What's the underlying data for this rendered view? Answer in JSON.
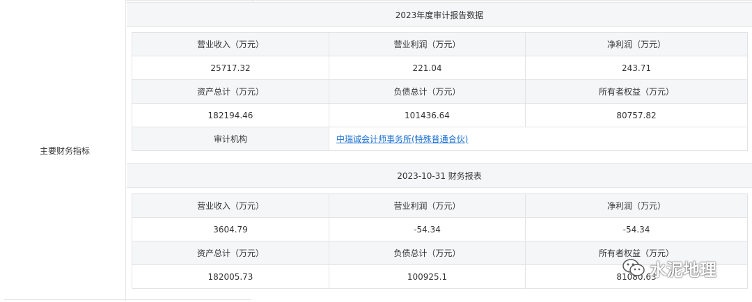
{
  "row_label": "主要财务指标",
  "sections": [
    {
      "header": "2023年度审计报告数据",
      "rows": [
        [
          "营业收入（万元）",
          "营业利润（万元）",
          "净利润（万元）"
        ],
        [
          "25717.32",
          "221.04",
          "243.71"
        ],
        [
          "资产总计（万元）",
          "负债总计（万元）",
          "所有者权益（万元）"
        ],
        [
          "182194.46",
          "101436.64",
          "80757.82"
        ]
      ],
      "auditor_label": "审计机构",
      "auditor_value": "中瑞诚会计师事务所(特殊普通合伙)"
    },
    {
      "header": "2023-10-31 财务报表",
      "rows": [
        [
          "营业收入（万元）",
          "营业利润（万元）",
          "净利润（万元）"
        ],
        [
          "3604.79",
          "-54.34",
          "-54.34"
        ],
        [
          "资产总计（万元）",
          "负债总计（万元）",
          "所有者权益（万元）"
        ],
        [
          "182005.73",
          "100925.1",
          "81080.63"
        ]
      ]
    }
  ],
  "watermark": {
    "text": "水泥地理",
    "icon": "wechat-icon"
  },
  "colors": {
    "header_bg": "#f5f6f8",
    "border": "#e3e3e3",
    "link": "#1a6fd1"
  }
}
